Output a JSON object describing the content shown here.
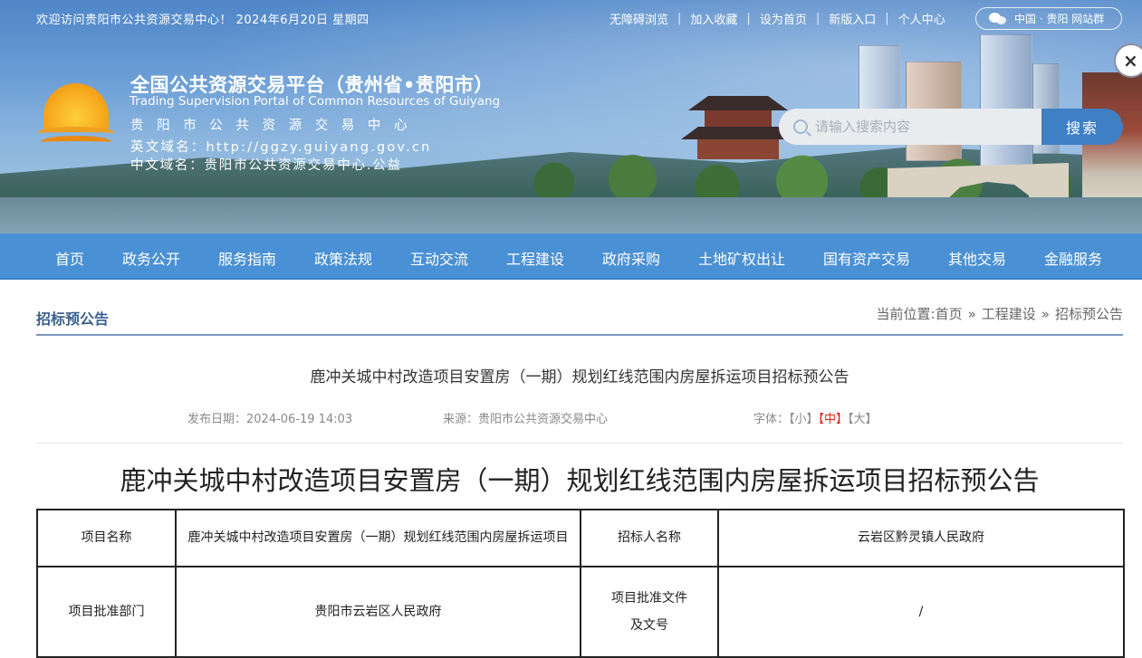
{
  "topbar": {
    "welcome": "欢迎访问贵阳市公共资源交易中心！  2024年6月20日 星期四",
    "links": [
      "无障碍浏览",
      "加入收藏",
      "设为首页",
      "新版入口",
      "个人中心"
    ],
    "wechat_pill": "中国 · 贵阳  网站群"
  },
  "header": {
    "title": "全国公共资源交易平台（贵州省•贵阳市）",
    "subtitle_en": "Trading Supervision Portal of Common Resources of Guiyang",
    "org_name": "贵阳市公共资源交易中心",
    "en_domain_line": "英文域名：http://ggzy.guiyang.gov.cn",
    "cn_domain_line": "中文域名：贵阳市公共资源交易中心.公益"
  },
  "search": {
    "placeholder": "请输入搜索内容",
    "button_label": "搜索"
  },
  "nav": {
    "items": [
      "首页",
      "政务公开",
      "服务指南",
      "政策法规",
      "互动交流",
      "工程建设",
      "政府采购",
      "土地矿权出让",
      "国有资产交易",
      "其他交易",
      "金融服务"
    ]
  },
  "content": {
    "section_label": "招标预公告",
    "breadcrumb": {
      "prefix": "当前位置:",
      "items": [
        "首页",
        "工程建设",
        "招标预公告"
      ],
      "separator": "»"
    },
    "doc_title": "鹿冲关城中村改造项目安置房（一期）规划红线范围内房屋拆运项目招标预公告",
    "meta": {
      "date": "发布日期：2024-06-19 14:03",
      "source": "来源：贵阳市公共资源交易中心",
      "font_label": "字体：",
      "font_small": "【小】",
      "font_medium": "【中】",
      "font_large": "【大】"
    },
    "big_title": "鹿冲关城中村改造项目安置房（一期）规划红线范围内房屋拆运项目招标预公告",
    "table": {
      "rows": [
        [
          "项目名称",
          "鹿冲关城中村改造项目安置房（一期）规划红线范围内房屋拆运项目",
          "招标人名称",
          "云岩区黔灵镇人民政府"
        ],
        [
          "项目批准部门",
          "贵阳市云岩区人民政府",
          "项目批准文件及文号",
          "/"
        ]
      ]
    }
  },
  "colors": {
    "nav_bg": "#4a90d4",
    "search_button": "#3f7fc4",
    "section_label": "#3b5f8a",
    "font_active": "#e0241a"
  }
}
